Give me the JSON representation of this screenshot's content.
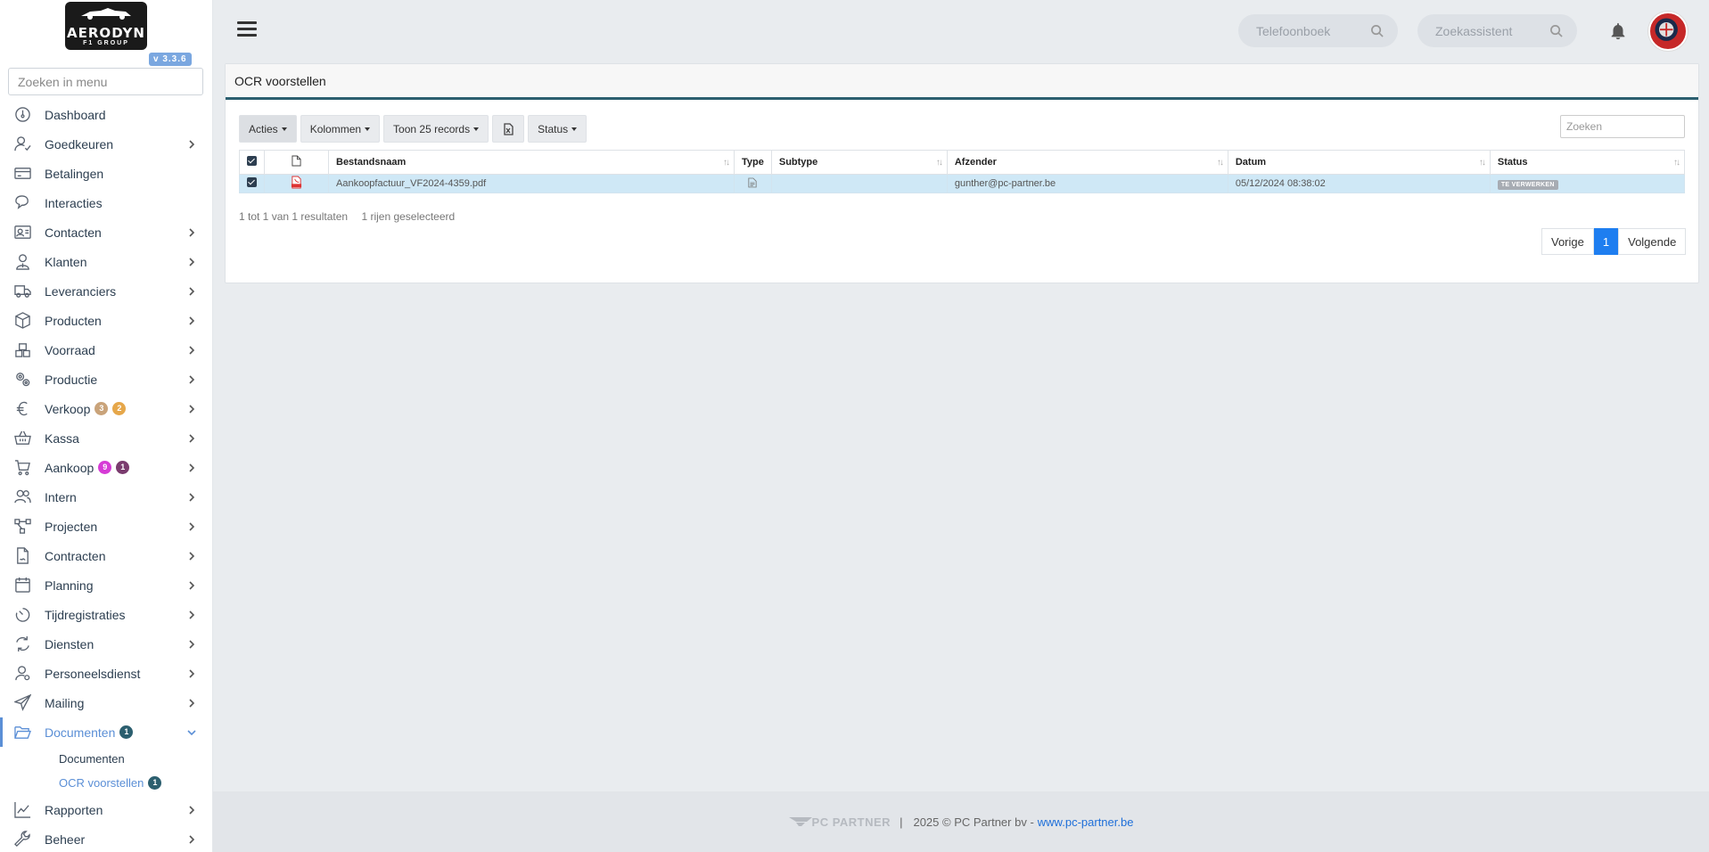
{
  "sidebar": {
    "logo_text": "AERODYN",
    "logo_sub": "F1 GROUP",
    "version": "v 3.3.6",
    "search_placeholder": "Zoeken in menu",
    "items": [
      {
        "label": "Dashboard",
        "icon": "dashboard-icon"
      },
      {
        "label": "Goedkeuren",
        "icon": "user-check-icon"
      },
      {
        "label": "Betalingen",
        "icon": "credit-card-icon"
      },
      {
        "label": "Interacties",
        "icon": "chat-icon"
      },
      {
        "label": "Contacten",
        "icon": "address-card-icon"
      },
      {
        "label": "Klanten",
        "icon": "user-tie-icon"
      },
      {
        "label": "Leveranciers",
        "icon": "truck-icon"
      },
      {
        "label": "Producten",
        "icon": "box-icon"
      },
      {
        "label": "Voorraad",
        "icon": "boxes-icon"
      },
      {
        "label": "Productie",
        "icon": "cogs-icon"
      },
      {
        "label": "Verkoop",
        "icon": "euro-icon",
        "badges": [
          "3",
          "2"
        ]
      },
      {
        "label": "Kassa",
        "icon": "basket-icon"
      },
      {
        "label": "Aankoop",
        "icon": "cart-icon",
        "badges": [
          "9",
          "1"
        ]
      },
      {
        "label": "Intern",
        "icon": "users-icon"
      },
      {
        "label": "Projecten",
        "icon": "project-diagram-icon"
      },
      {
        "label": "Contracten",
        "icon": "file-contract-icon"
      },
      {
        "label": "Planning",
        "icon": "calendar-icon"
      },
      {
        "label": "Tijdregistraties",
        "icon": "stopwatch-icon"
      },
      {
        "label": "Diensten",
        "icon": "sync-icon"
      },
      {
        "label": "Personeelsdienst",
        "icon": "user-cog-icon"
      },
      {
        "label": "Mailing",
        "icon": "paper-plane-icon"
      },
      {
        "label": "Documenten",
        "icon": "folder-open-icon",
        "badges": [
          "1"
        ]
      }
    ],
    "sub_items": [
      {
        "label": "Documenten"
      },
      {
        "label": "OCR voorstellen",
        "badge": "1"
      }
    ],
    "after_items": [
      {
        "label": "Rapporten",
        "icon": "chart-line-icon"
      },
      {
        "label": "Beheer",
        "icon": "wrench-icon"
      }
    ]
  },
  "topbar": {
    "phonebook_placeholder": "Telefoonboek",
    "assistant_placeholder": "Zoekassistent"
  },
  "card": {
    "title": "OCR voorstellen",
    "toolbar": {
      "actions": "Acties",
      "columns": "Kolommen",
      "show_records": "Toon 25 records",
      "status": "Status",
      "search_placeholder": "Zoeken"
    },
    "columns": [
      "Bestandsnaam",
      "Type",
      "Subtype",
      "Afzender",
      "Datum",
      "Status"
    ],
    "rows": [
      {
        "filename": "Aankoopfactuur_VF2024-4359.pdf",
        "subtype": "",
        "sender": "gunther@pc-partner.be",
        "date": "05/12/2024 08:38:02",
        "status": "TE VERWERKEN"
      }
    ],
    "result_info": "1 tot 1 van 1 resultaten",
    "selected_info": "1 rijen geselecteerd",
    "pager": {
      "prev": "Vorige",
      "current": "1",
      "next": "Volgende"
    }
  },
  "footer": {
    "brand": "PC PARTNER",
    "separator": "|",
    "copyright": "2025 © PC Partner bv -",
    "link": "www.pc-partner.be"
  },
  "colors": {
    "accent": "#5b8fd6",
    "header_border": "#2c5f6f",
    "row_selected": "#cfe8f6",
    "page_active": "#1e7ef0",
    "badge_orange": "#e6a74a",
    "badge_tan": "#c9a37a",
    "badge_magenta": "#d63bd6",
    "badge_purple": "#7a3b6e",
    "badge_teal": "#2c5f6f"
  }
}
